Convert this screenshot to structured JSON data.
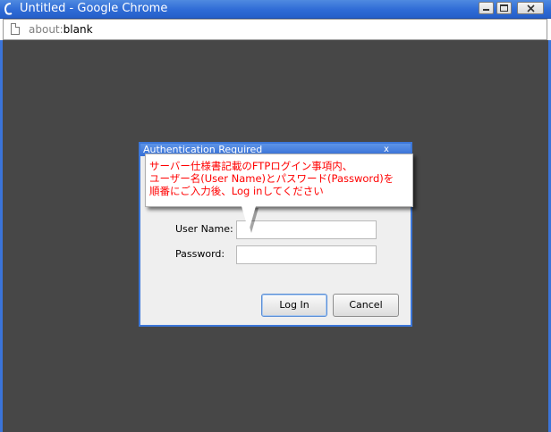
{
  "window": {
    "title": "Untitled - Google Chrome",
    "controls": {
      "minimize": "minimize",
      "maximize": "maximize",
      "close": "close"
    }
  },
  "address_bar": {
    "scheme": "about:",
    "rest": "blank"
  },
  "dialog": {
    "title": "Authentication Required",
    "close_label": "x",
    "user_label": "User Name:",
    "user_value": "",
    "password_label": "Password:",
    "password_value": "",
    "login_button": "Log In",
    "cancel_button": "Cancel"
  },
  "annotation": {
    "line1": "サーバー仕様書記載のFTPログイン事項内、",
    "line2": "ユーザー名(User Name)とパスワード(Password)を",
    "line3": "順番にご入力後、Log inしてください",
    "text_color": "#ff0000"
  },
  "colors": {
    "titlebar": "#2f6bd6",
    "content_background": "#474747",
    "dialog_border": "#3c77d9"
  }
}
